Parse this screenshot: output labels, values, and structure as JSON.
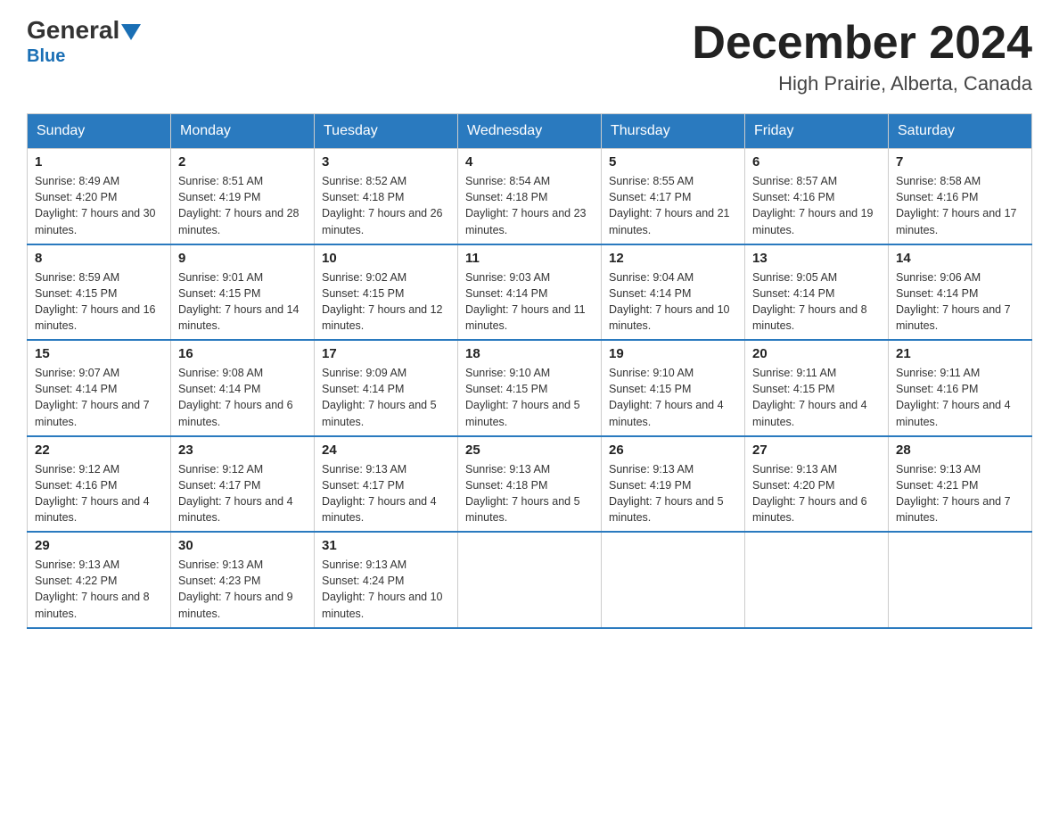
{
  "header": {
    "logo_general": "General",
    "logo_blue": "Blue",
    "month_title": "December 2024",
    "location": "High Prairie, Alberta, Canada"
  },
  "days_of_week": [
    "Sunday",
    "Monday",
    "Tuesday",
    "Wednesday",
    "Thursday",
    "Friday",
    "Saturday"
  ],
  "weeks": [
    [
      {
        "day": "1",
        "sunrise": "8:49 AM",
        "sunset": "4:20 PM",
        "daylight": "7 hours and 30 minutes."
      },
      {
        "day": "2",
        "sunrise": "8:51 AM",
        "sunset": "4:19 PM",
        "daylight": "7 hours and 28 minutes."
      },
      {
        "day": "3",
        "sunrise": "8:52 AM",
        "sunset": "4:18 PM",
        "daylight": "7 hours and 26 minutes."
      },
      {
        "day": "4",
        "sunrise": "8:54 AM",
        "sunset": "4:18 PM",
        "daylight": "7 hours and 23 minutes."
      },
      {
        "day": "5",
        "sunrise": "8:55 AM",
        "sunset": "4:17 PM",
        "daylight": "7 hours and 21 minutes."
      },
      {
        "day": "6",
        "sunrise": "8:57 AM",
        "sunset": "4:16 PM",
        "daylight": "7 hours and 19 minutes."
      },
      {
        "day": "7",
        "sunrise": "8:58 AM",
        "sunset": "4:16 PM",
        "daylight": "7 hours and 17 minutes."
      }
    ],
    [
      {
        "day": "8",
        "sunrise": "8:59 AM",
        "sunset": "4:15 PM",
        "daylight": "7 hours and 16 minutes."
      },
      {
        "day": "9",
        "sunrise": "9:01 AM",
        "sunset": "4:15 PM",
        "daylight": "7 hours and 14 minutes."
      },
      {
        "day": "10",
        "sunrise": "9:02 AM",
        "sunset": "4:15 PM",
        "daylight": "7 hours and 12 minutes."
      },
      {
        "day": "11",
        "sunrise": "9:03 AM",
        "sunset": "4:14 PM",
        "daylight": "7 hours and 11 minutes."
      },
      {
        "day": "12",
        "sunrise": "9:04 AM",
        "sunset": "4:14 PM",
        "daylight": "7 hours and 10 minutes."
      },
      {
        "day": "13",
        "sunrise": "9:05 AM",
        "sunset": "4:14 PM",
        "daylight": "7 hours and 8 minutes."
      },
      {
        "day": "14",
        "sunrise": "9:06 AM",
        "sunset": "4:14 PM",
        "daylight": "7 hours and 7 minutes."
      }
    ],
    [
      {
        "day": "15",
        "sunrise": "9:07 AM",
        "sunset": "4:14 PM",
        "daylight": "7 hours and 7 minutes."
      },
      {
        "day": "16",
        "sunrise": "9:08 AM",
        "sunset": "4:14 PM",
        "daylight": "7 hours and 6 minutes."
      },
      {
        "day": "17",
        "sunrise": "9:09 AM",
        "sunset": "4:14 PM",
        "daylight": "7 hours and 5 minutes."
      },
      {
        "day": "18",
        "sunrise": "9:10 AM",
        "sunset": "4:15 PM",
        "daylight": "7 hours and 5 minutes."
      },
      {
        "day": "19",
        "sunrise": "9:10 AM",
        "sunset": "4:15 PM",
        "daylight": "7 hours and 4 minutes."
      },
      {
        "day": "20",
        "sunrise": "9:11 AM",
        "sunset": "4:15 PM",
        "daylight": "7 hours and 4 minutes."
      },
      {
        "day": "21",
        "sunrise": "9:11 AM",
        "sunset": "4:16 PM",
        "daylight": "7 hours and 4 minutes."
      }
    ],
    [
      {
        "day": "22",
        "sunrise": "9:12 AM",
        "sunset": "4:16 PM",
        "daylight": "7 hours and 4 minutes."
      },
      {
        "day": "23",
        "sunrise": "9:12 AM",
        "sunset": "4:17 PM",
        "daylight": "7 hours and 4 minutes."
      },
      {
        "day": "24",
        "sunrise": "9:13 AM",
        "sunset": "4:17 PM",
        "daylight": "7 hours and 4 minutes."
      },
      {
        "day": "25",
        "sunrise": "9:13 AM",
        "sunset": "4:18 PM",
        "daylight": "7 hours and 5 minutes."
      },
      {
        "day": "26",
        "sunrise": "9:13 AM",
        "sunset": "4:19 PM",
        "daylight": "7 hours and 5 minutes."
      },
      {
        "day": "27",
        "sunrise": "9:13 AM",
        "sunset": "4:20 PM",
        "daylight": "7 hours and 6 minutes."
      },
      {
        "day": "28",
        "sunrise": "9:13 AM",
        "sunset": "4:21 PM",
        "daylight": "7 hours and 7 minutes."
      }
    ],
    [
      {
        "day": "29",
        "sunrise": "9:13 AM",
        "sunset": "4:22 PM",
        "daylight": "7 hours and 8 minutes."
      },
      {
        "day": "30",
        "sunrise": "9:13 AM",
        "sunset": "4:23 PM",
        "daylight": "7 hours and 9 minutes."
      },
      {
        "day": "31",
        "sunrise": "9:13 AM",
        "sunset": "4:24 PM",
        "daylight": "7 hours and 10 minutes."
      },
      null,
      null,
      null,
      null
    ]
  ]
}
